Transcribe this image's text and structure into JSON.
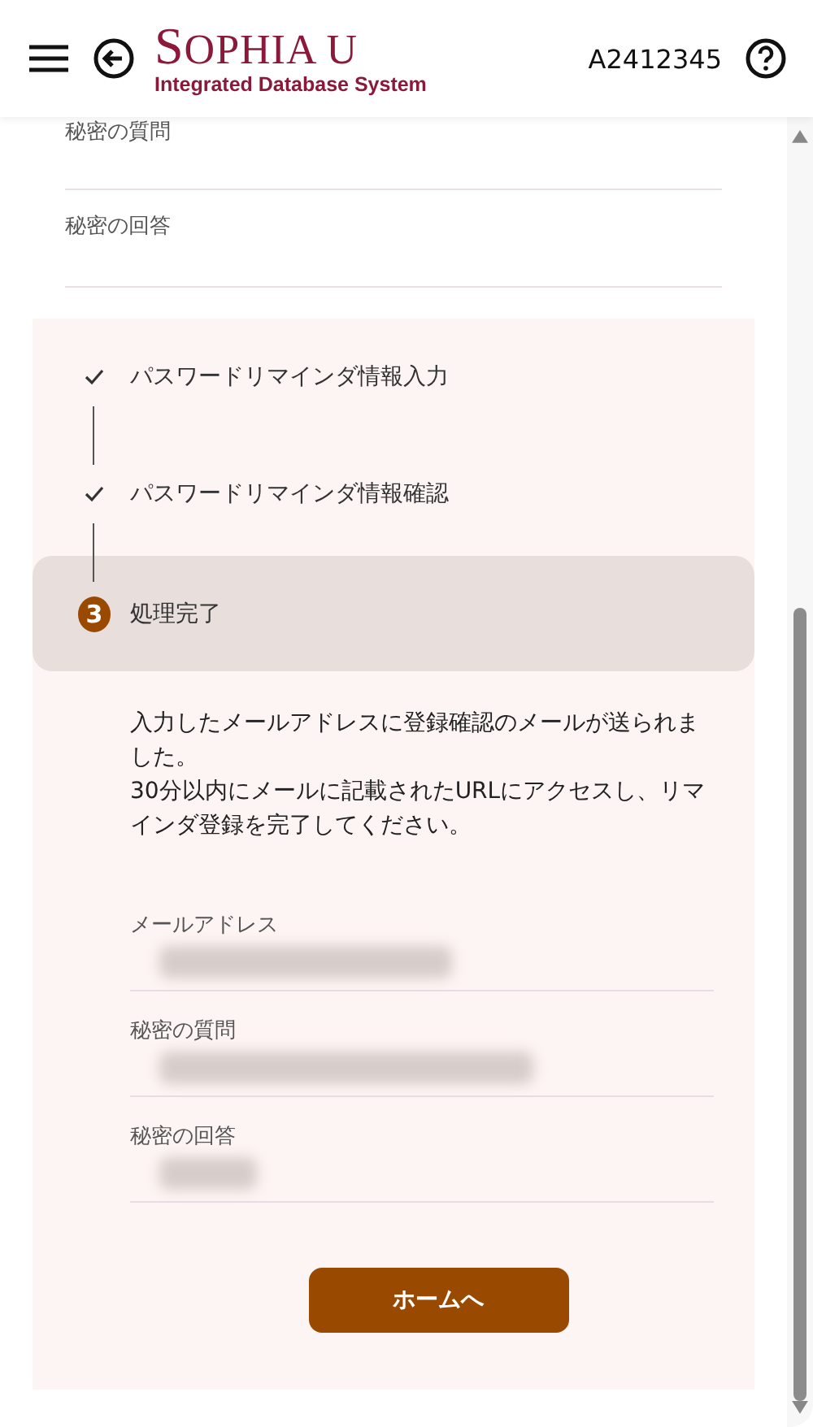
{
  "header": {
    "logo_title": "SOPHIA U",
    "logo_subtitle": "Integrated Database System",
    "user_id": "A2412345"
  },
  "top_fields": [
    {
      "label": "秘密の質問"
    },
    {
      "label": "秘密の回答"
    }
  ],
  "steps": [
    {
      "label": "パスワードリマインダ情報入力",
      "kind": "done",
      "selected": false
    },
    {
      "label": "パスワードリマインダ情報確認",
      "kind": "done",
      "selected": false
    },
    {
      "label": "処理完了",
      "kind": "current",
      "number": "3",
      "selected": true
    }
  ],
  "message": [
    "入力したメールアドレスに登録確認のメールが送られました。",
    "30分以内にメールに記載されたURLにアクセスし、リマインダ登録を完了してください。"
  ],
  "result_fields": [
    {
      "label": "メールアドレス",
      "blurred": true
    },
    {
      "label": "秘密の質問",
      "blurred": true
    },
    {
      "label": "秘密の回答",
      "blurred": true
    }
  ],
  "home_button": "ホームへ"
}
